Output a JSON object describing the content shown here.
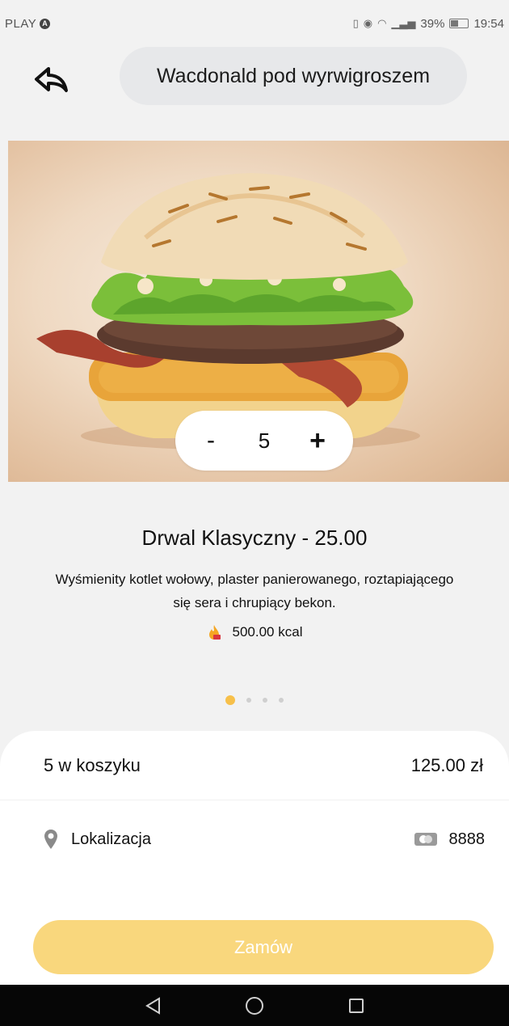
{
  "status_bar": {
    "carrier": "PLAY",
    "carrier_badge": "A",
    "battery_percent": "39%",
    "time": "19:54"
  },
  "header": {
    "title": "Wacdonald pod wyrwigroszem"
  },
  "product": {
    "name": "Drwal Klasyczny - 25.00",
    "description": "Wyśmienity kotlet wołowy, plaster panierowanego, roztapiającego się sera i chrupiący bekon.",
    "kcal": "500.00 kcal"
  },
  "quantity": {
    "minus_label": "-",
    "value": "5",
    "plus_label": "+"
  },
  "pager": {
    "count": 4,
    "active_index": 0
  },
  "cart": {
    "count_label": "5 w koszyku",
    "total": "125.00 zł"
  },
  "location": {
    "label": "Lokalizacja",
    "card_value": "8888"
  },
  "order_button": {
    "label": "Zamów"
  },
  "colors": {
    "accent": "#f7c04a",
    "order_button_bg": "#f9d77d",
    "title_pill_bg": "#e7e8ea",
    "page_bg": "#f2f2f2"
  },
  "icons": {
    "back": "back-arrow-icon",
    "kcal": "flame-icon",
    "location": "location-pin-icon",
    "card": "card-icon",
    "nav_back": "triangle-back-icon",
    "nav_home": "circle-home-icon",
    "nav_recents": "square-recents-icon"
  }
}
